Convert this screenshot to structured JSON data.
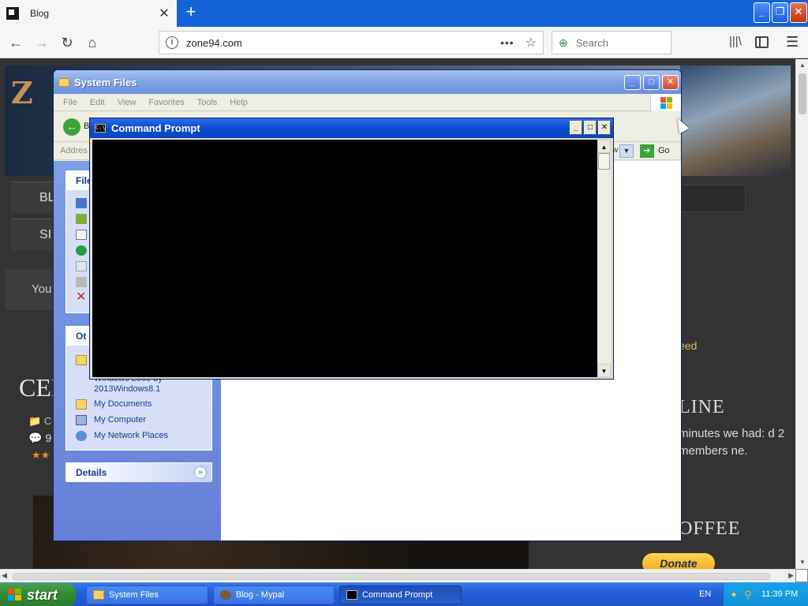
{
  "browser": {
    "tab_title": "Blog",
    "tab_close": "✕",
    "new_tab": "+",
    "url": "zone94.com",
    "search_placeholder": "Search",
    "page_actions": "•••",
    "bookmark_star": "☆",
    "library": "|||\\",
    "menu": "☰",
    "window_min": "_",
    "window_restore": "❐",
    "window_close": "✕"
  },
  "webpage": {
    "logo_letter": "Z",
    "nav_blog": "BL",
    "nav_si": "SI",
    "you_text": "You",
    "post_title_partial": "CEL",
    "post_meta_partial": "C",
    "post_comments_partial": "9",
    "stars": "★★",
    "feed_partial": "eed",
    "online_heading": "LINE",
    "online_text": "minutes we had: d 2 members ne.",
    "coffee_heading": "OFFEE",
    "donate": "Donate"
  },
  "explorer": {
    "title": "System Files",
    "menu": [
      "File",
      "Edit",
      "View",
      "Favorites",
      "Tools",
      "Help"
    ],
    "back_label": "B",
    "address_label": "Addres",
    "address_dropdown_edge": "w",
    "go_label": "Go",
    "file_tasks_header": "File",
    "other_places_header": "Ot",
    "other_places": [
      "Windows 2000 by 2013Windows8.1",
      "My Documents",
      "My Computer",
      "My Network Places"
    ],
    "details_header": "Details"
  },
  "cmd": {
    "title": "Command Prompt",
    "icon_text": "C:\\"
  },
  "taskbar": {
    "start": "start",
    "items": [
      "System Files",
      "Blog - Mypal",
      "Command Prompt"
    ],
    "lang": "EN",
    "clock": "11:39 PM"
  }
}
